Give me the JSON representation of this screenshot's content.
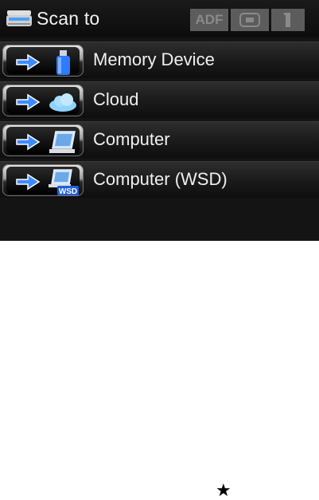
{
  "header": {
    "title": "Scan to",
    "icon": "scanner-icon",
    "status": {
      "adf_label": "ADF",
      "card_icon": "memory-card-icon",
      "info_icon": "info-icon"
    }
  },
  "menu": {
    "items": [
      {
        "label": "Memory Device",
        "icon": "usb-drive-icon"
      },
      {
        "label": "Cloud",
        "icon": "cloud-icon"
      },
      {
        "label": "Computer",
        "icon": "computer-icon"
      },
      {
        "label": "Computer (WSD)",
        "icon": "computer-wsd-icon",
        "badge": "WSD"
      }
    ]
  },
  "footer": {
    "mark": "★"
  },
  "colors": {
    "screen_bg": "#141414",
    "arrow_blue": "#3d8bff",
    "text": "#f0f0f0",
    "status_bg": "#5c5c5c"
  }
}
